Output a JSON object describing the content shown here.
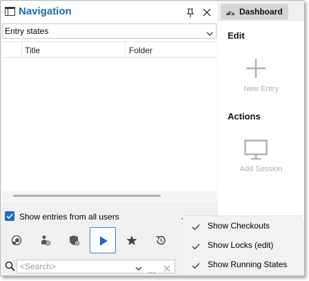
{
  "navigation": {
    "title": "Navigation",
    "filter_value": "Entry states",
    "columns": [
      "Title",
      "Folder"
    ],
    "show_all_users_label": "Show entries from all users",
    "show_all_users_checked": true,
    "more_label": "⋯",
    "search_placeholder": "<Search>",
    "toolbar": [
      {
        "name": "checkouts-filter-icon"
      },
      {
        "name": "user-locks-filter-icon"
      },
      {
        "name": "shield-locks-filter-icon"
      },
      {
        "name": "running-states-icon",
        "active": true
      },
      {
        "name": "favorites-star-icon"
      },
      {
        "name": "history-icon"
      }
    ]
  },
  "dashboard": {
    "tab_label": "Dashboard",
    "edit_title": "Edit",
    "new_entry_label": "New Entry",
    "actions_title": "Actions",
    "add_session_label": "Add Session"
  },
  "context_menu": {
    "items": [
      {
        "label": "Show Checkouts",
        "checked": true
      },
      {
        "label": "Show Locks (edit)",
        "checked": true
      },
      {
        "label": "Show Running States",
        "checked": true
      }
    ]
  },
  "colors": {
    "title_blue": "#1b6ab7",
    "checkbox_blue": "#1e6cc1",
    "play_blue": "#1e6cc1",
    "disabled_gray": "#b0b0b0"
  }
}
